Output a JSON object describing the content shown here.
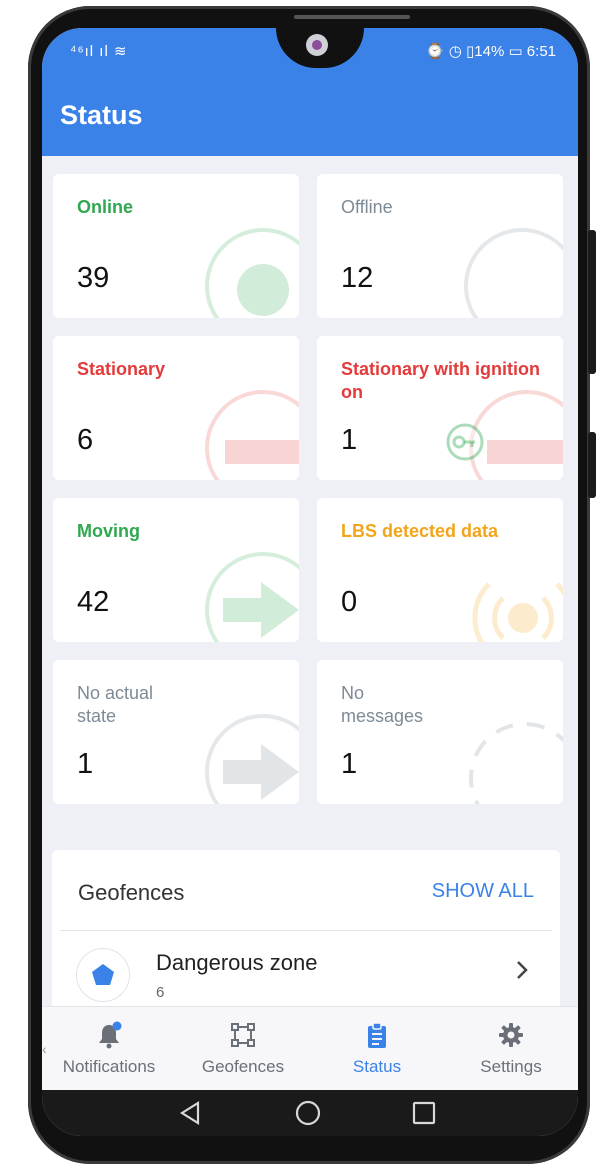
{
  "statusbar": {
    "left_icons": "⁴⁶ıl ıl ≋",
    "right_text": "⌚ ◷ ▯14% ▭ 6:51"
  },
  "app": {
    "title": "Status"
  },
  "cards": [
    {
      "label": "Online",
      "count": "39",
      "color": "#2fa84f",
      "icon": "online-status-icon"
    },
    {
      "label": "Offline",
      "count": "12",
      "color": "#7d8a96",
      "icon": "offline-status-icon"
    },
    {
      "label": "Stationary",
      "count": "6",
      "color": "#e33b3b",
      "icon": "stationary-status-icon"
    },
    {
      "label": "Stationary with ignition on",
      "count": "1",
      "color": "#e33b3b",
      "icon": "ignition-key-icon"
    },
    {
      "label": "Moving",
      "count": "42",
      "color": "#2fa84f",
      "icon": "moving-arrow-icon"
    },
    {
      "label": "LBS detected data",
      "count": "0",
      "color": "#f2a51a",
      "icon": "lbs-signal-icon"
    },
    {
      "label": "No actual state",
      "count": "1",
      "color": "#7d8a96",
      "icon": "no-state-arrow-icon"
    },
    {
      "label": "No messages",
      "count": "1",
      "color": "#7d8a96",
      "icon": "no-messages-icon"
    }
  ],
  "geofences": {
    "title": "Geofences",
    "show_all": "SHOW ALL",
    "items": [
      {
        "name": "Dangerous zone",
        "count": "6"
      }
    ]
  },
  "nav": {
    "items": [
      {
        "label": "Notifications",
        "icon": "bell-icon"
      },
      {
        "label": "Geofences",
        "icon": "geofence-polygon-icon"
      },
      {
        "label": "Status",
        "icon": "clipboard-icon"
      },
      {
        "label": "Settings",
        "icon": "gear-icon"
      }
    ]
  },
  "colors": {
    "accent": "#3b82e8",
    "green": "#2fa84f",
    "red": "#e33b3b",
    "orange": "#f2a51a",
    "grey": "#7d8a96"
  }
}
